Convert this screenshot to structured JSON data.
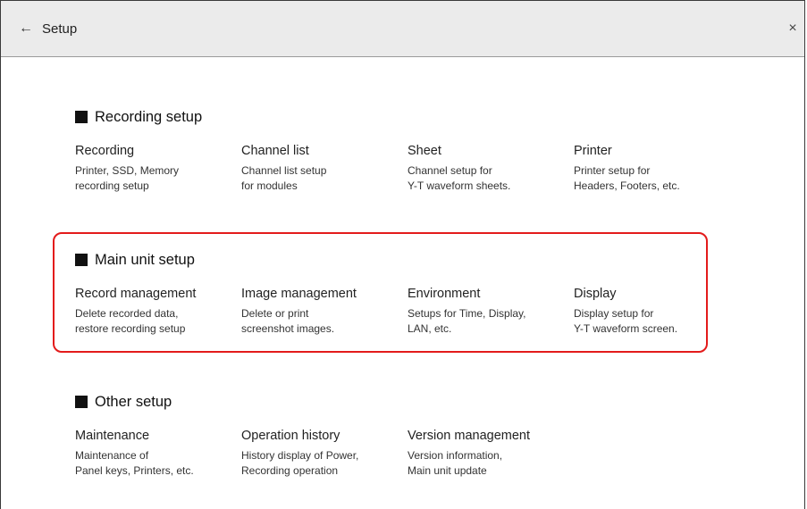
{
  "header": {
    "back_icon": "←",
    "title": "Setup",
    "close_icon": "×"
  },
  "sections": [
    {
      "title": "Recording setup",
      "items": [
        {
          "label": "Recording",
          "desc_line1": "Printer, SSD, Memory",
          "desc_line2": "recording setup"
        },
        {
          "label": "Channel list",
          "desc_line1": "Channel list setup",
          "desc_line2": "for modules"
        },
        {
          "label": "Sheet",
          "desc_line1": "Channel setup for",
          "desc_line2": "Y-T waveform sheets."
        },
        {
          "label": "Printer",
          "desc_line1": "Printer setup for",
          "desc_line2": "Headers, Footers, etc."
        }
      ]
    },
    {
      "title": "Main unit setup",
      "items": [
        {
          "label": "Record management",
          "desc_line1": "Delete recorded data,",
          "desc_line2": "restore recording setup"
        },
        {
          "label": "Image management",
          "desc_line1": "Delete or print",
          "desc_line2": "screenshot images."
        },
        {
          "label": "Environment",
          "desc_line1": "Setups for Time, Display,",
          "desc_line2": "LAN, etc."
        },
        {
          "label": "Display",
          "desc_line1": "Display setup for",
          "desc_line2": "Y-T waveform screen."
        }
      ]
    },
    {
      "title": "Other setup",
      "items": [
        {
          "label": "Maintenance",
          "desc_line1": "Maintenance of",
          "desc_line2": "Panel keys, Printers, etc."
        },
        {
          "label": "Operation history",
          "desc_line1": "History display of Power,",
          "desc_line2": "Recording operation"
        },
        {
          "label": "Version management",
          "desc_line1": "Version information,",
          "desc_line2": "Main unit update"
        }
      ]
    }
  ],
  "colors": {
    "highlight_border": "#e31b1b",
    "titlebar_bg": "#ebebeb"
  }
}
